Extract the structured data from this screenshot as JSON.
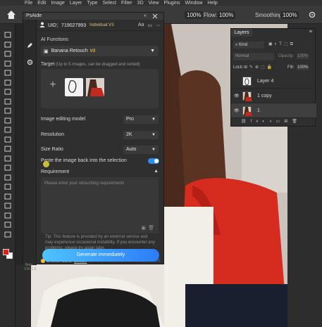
{
  "menubar": [
    "File",
    "Edit",
    "Image",
    "Layer",
    "Type",
    "Select",
    "Filter",
    "3D",
    "View",
    "Plugins",
    "Window",
    "Help"
  ],
  "options": {
    "flow_label": "Flow:",
    "flow_value": "100%",
    "opacity_value": "100%",
    "smoothing_label": "Smoothing:",
    "smoothing_value": "100%"
  },
  "psaide": {
    "title": "PsAide",
    "uid": "UID：719027993",
    "plan": "Individual V3",
    "ai_functions_label": "AI Functions",
    "function_selected": "Banana Retouch",
    "function_badge": "V3",
    "target_label": "Target",
    "target_hint": "(Up to 5 images, can be dragged and sorted)",
    "editing_model_label": "Image editing model",
    "editing_model_value": "Pro",
    "resolution_label": "Resolution",
    "resolution_value": "2K",
    "size_ratio_label": "Size Ratio",
    "size_ratio_value": "Auto",
    "paste_label": "Paste the image back into the selection",
    "requirement_label": "Requirement",
    "requirement_placeholder": "Please enter your retouching requirements",
    "tip": "Tip: This feature is provided by an external service and may experience occasional instability. If you encounter any problems, please try again later.",
    "credits_label": "Credits: 2181",
    "details_label": "Details",
    "get_credits_label": "Get Credits",
    "generate_label": "Generate immediately",
    "beta_label": "Beta",
    "version_label": "V36.1.0"
  },
  "layers": {
    "tab": "Layers",
    "kind_label": "Kind",
    "blend_mode": "Normal",
    "opacity_label": "Opacity:",
    "opacity_value": "100%",
    "lock_label": "Lock:",
    "fill_label": "Fill:",
    "fill_value": "100%",
    "items": [
      {
        "name": "Layer 4"
      },
      {
        "name": "1 copy"
      },
      {
        "name": "1"
      }
    ]
  },
  "colors": {
    "accent": "#2d8cf0",
    "dress_red": "#d62b1f",
    "foreground_swatch": "#e01e14"
  }
}
